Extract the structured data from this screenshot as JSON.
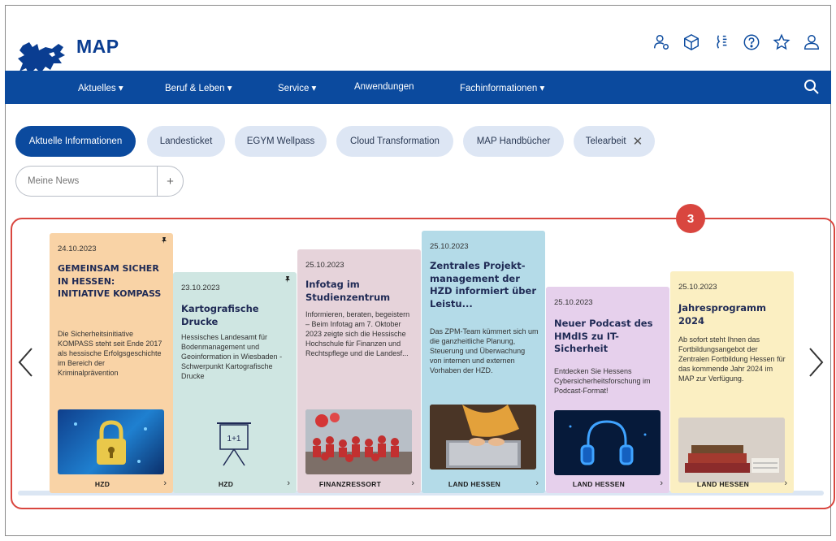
{
  "header": {
    "brand": "MAP"
  },
  "nav": {
    "items": [
      "Aktuelles ▾",
      "Beruf & Leben ▾",
      "Service ▾",
      "Anwendungen",
      "Fachinformationen ▾"
    ]
  },
  "chips": [
    {
      "label": "Aktuelle Informationen"
    },
    {
      "label": "Landesticket"
    },
    {
      "label": "EGYM Wellpass"
    },
    {
      "label": "Cloud Transformation"
    },
    {
      "label": "MAP Handbücher"
    },
    {
      "label": "Telearbeit",
      "close": "✕"
    }
  ],
  "news": {
    "placeholder": "Meine News",
    "add": "+"
  },
  "badge": "3",
  "cards": [
    {
      "date": "24.10.2023",
      "title": "GEMEINSAM SICHER IN HESSEN: INITIATIVE KOMPASS",
      "text": "Die Sicherheitsinitiative KOMPASS steht seit Ende 2017 als hessische Erfolgsgeschichte im Bereich der Kriminalprävention",
      "source": "HZD",
      "chevron": "›",
      "color": "#f9d3a6"
    },
    {
      "date": "23.10.2023",
      "title": "Kartografische Drucke",
      "text": "Hessisches Landesamt für Bodenmanagement und Geoinformation in Wiesbaden - Schwerpunkt Kartografische Drucke",
      "source": "HZD",
      "chevron": "›",
      "icon_label": "1+1",
      "color": "#cfe6e2"
    },
    {
      "date": "25.10.2023",
      "title": "Infotag im Studienzentrum",
      "text": "Informieren, beraten, begeistern – Beim Infotag am 7. Oktober 2023 zeigte sich die Hessische Hochschule für Finanzen und Rechtspflege und die Landesf...",
      "source": "FINANZRESSORT",
      "chevron": "›",
      "color": "#e6d3da"
    },
    {
      "date": "25.10.2023",
      "title": "Zentrales Projekt-management der HZD informiert über Leistu...",
      "text": "Das ZPM-Team kümmert sich um die ganzheitliche Planung, Steuerung und Überwachung von internen und externen Vorhaben der HZD.",
      "source": "LAND HESSEN",
      "chevron": "›",
      "color": "#b4dbe8"
    },
    {
      "date": "25.10.2023",
      "title": "Neuer Podcast des HMdIS zu IT-Sicherheit",
      "text": "Entdecken Sie Hessens Cybersicherheitsforschung im Podcast-Format!",
      "source": "LAND HESSEN",
      "chevron": "›",
      "color": "#e6d0ec"
    },
    {
      "date": "25.10.2023",
      "title": "Jahresprogramm 2024",
      "text": "Ab sofort steht Ihnen das Fortbildungsangebot der Zentralen Fortbildung Hessen für das kommende Jahr 2024 im MAP zur Verfügung.",
      "source": "LAND HESSEN",
      "chevron": "›",
      "color": "#fbefc2"
    }
  ]
}
